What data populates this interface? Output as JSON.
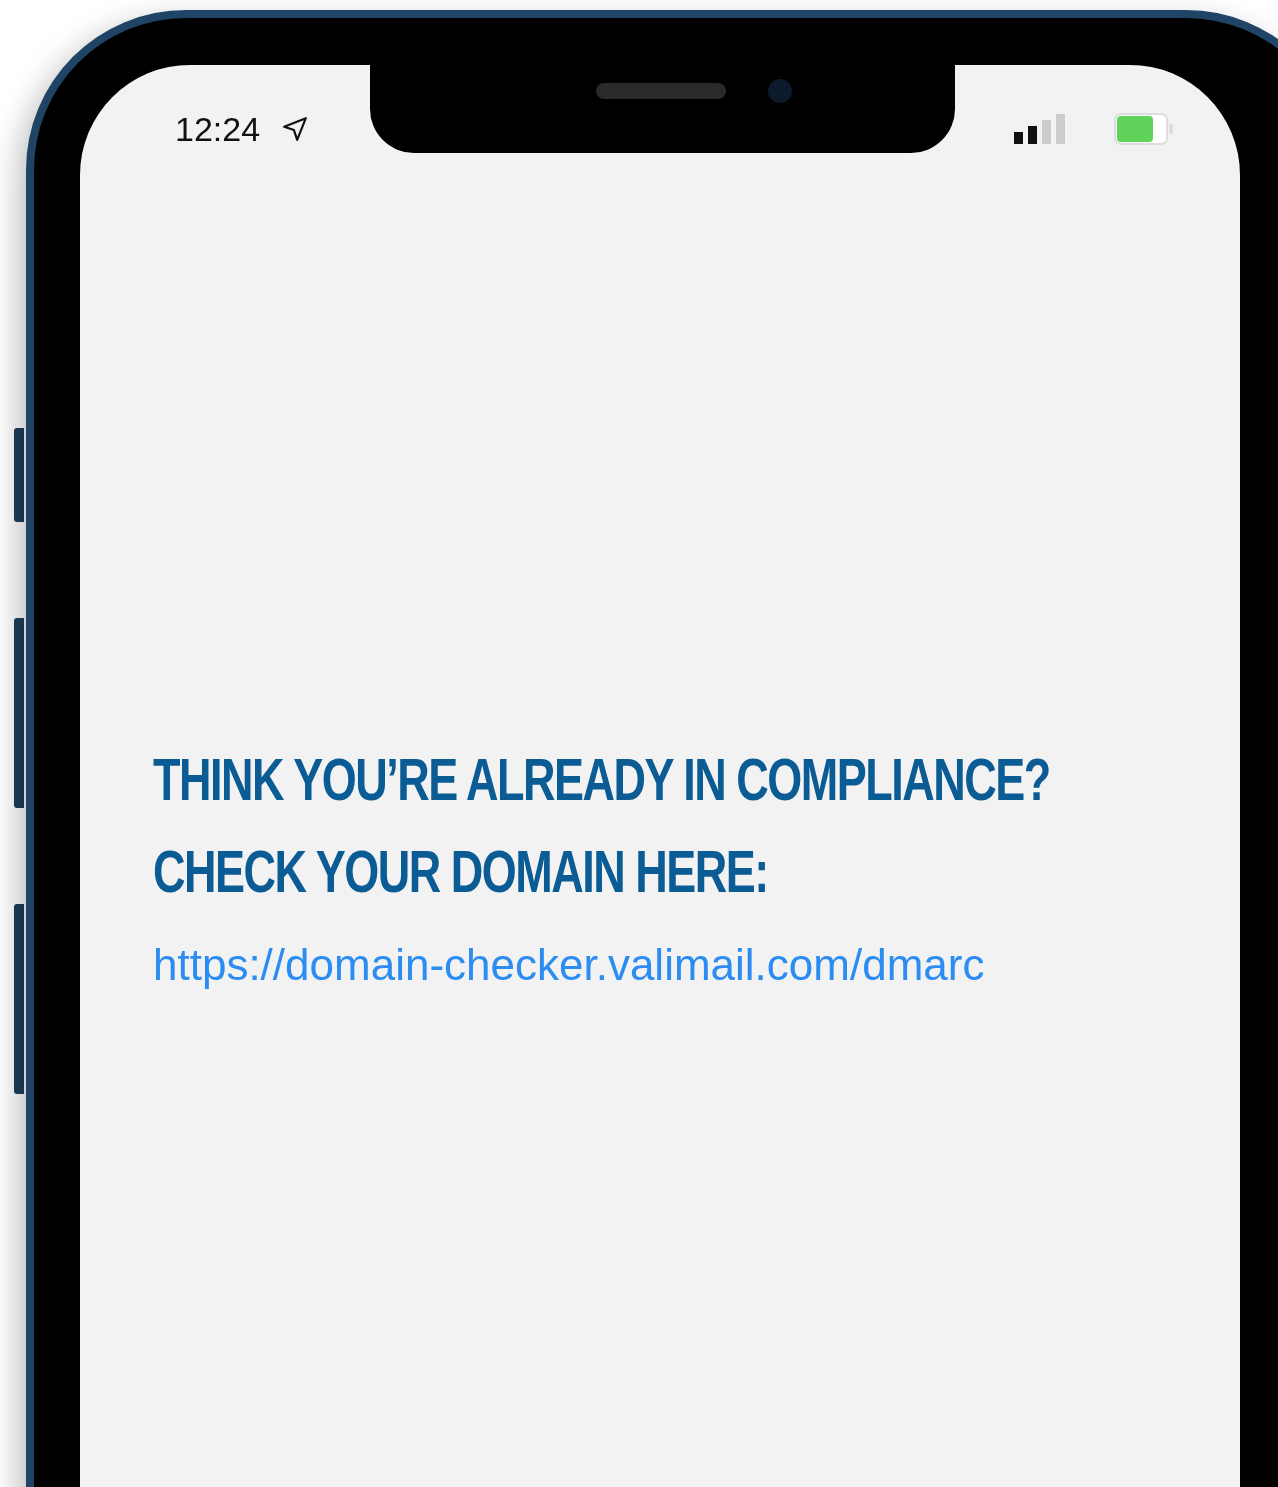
{
  "status_bar": {
    "time": "12:24"
  },
  "headline": [
    "THINK YOU’RE ALREADY IN COMPLIANCE?",
    "CHECK YOUR DOMAIN HERE:"
  ],
  "link": "https://domain-checker.valimail.com/dmarc"
}
